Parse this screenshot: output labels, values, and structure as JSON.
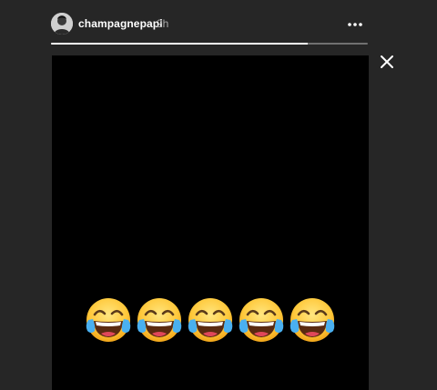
{
  "story": {
    "username": "champagnepapi",
    "timestamp": "2h",
    "progress": 0.81,
    "accent_progress": "#ffffff",
    "icons": {
      "more": "more-options-icon",
      "close": "close-icon",
      "avatar": "profile-avatar"
    },
    "sticker": {
      "emoji": "face-with-tears-of-joy",
      "count": 5
    }
  }
}
